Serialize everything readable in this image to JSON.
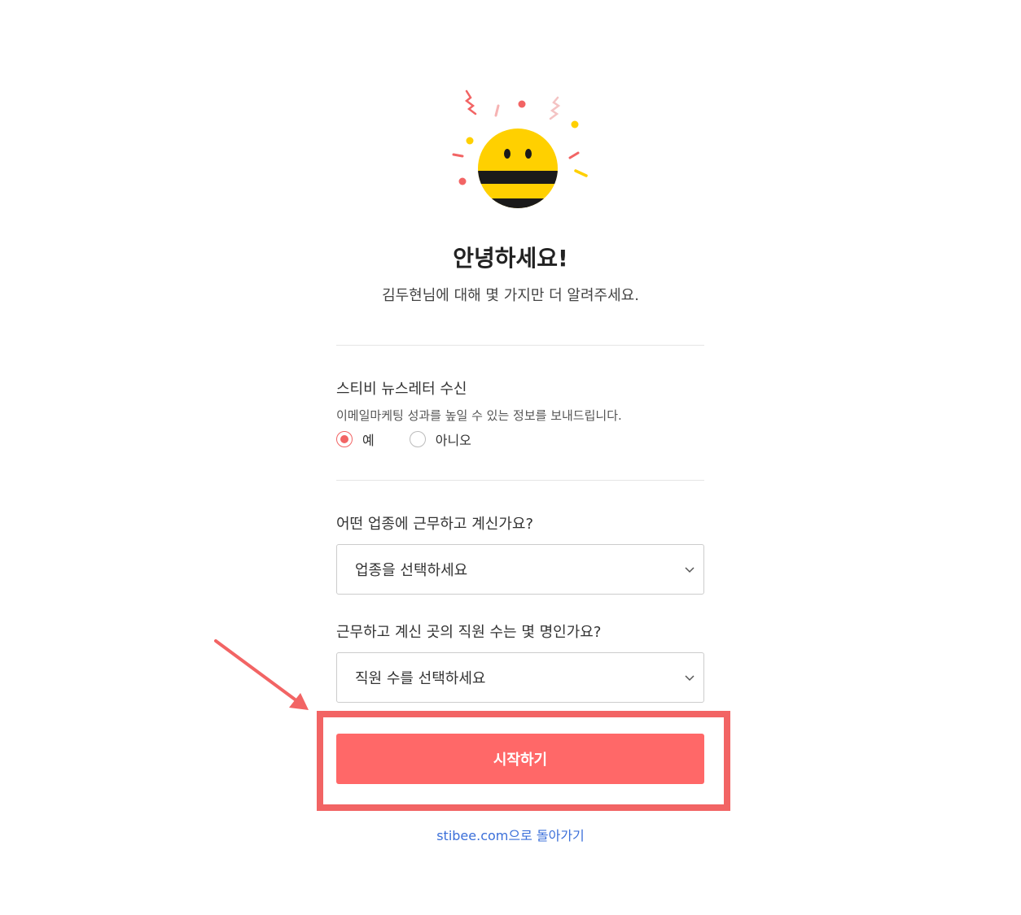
{
  "header": {
    "title": "안녕하세요!",
    "subtitle": "김두현님에 대해 몇 가지만 더 알려주세요."
  },
  "newsletter": {
    "title": "스티비 뉴스레터 수신",
    "description": "이메일마케팅 성과를 높일 수 있는 정보를 보내드립니다.",
    "options": [
      {
        "label": "예",
        "checked": true
      },
      {
        "label": "아니오",
        "checked": false
      }
    ]
  },
  "industry": {
    "question": "어떤 업종에 근무하고 계신가요?",
    "placeholder": "업종을 선택하세요"
  },
  "employees": {
    "question": "근무하고 계신 곳의 직원 수는 몇 명인가요?",
    "placeholder": "직원 수를 선택하세요"
  },
  "actions": {
    "start_label": "시작하기",
    "back_link": "stibee.com으로 돌아가기"
  },
  "colors": {
    "accent": "#ff6868",
    "highlight": "#f26464",
    "link": "#3b6fd9",
    "mascot_yellow": "#ffd000"
  },
  "icons": {
    "mascot": "bee-mascot-icon",
    "dropdown": "chevron-down-icon",
    "annotation": "arrow-icon"
  }
}
